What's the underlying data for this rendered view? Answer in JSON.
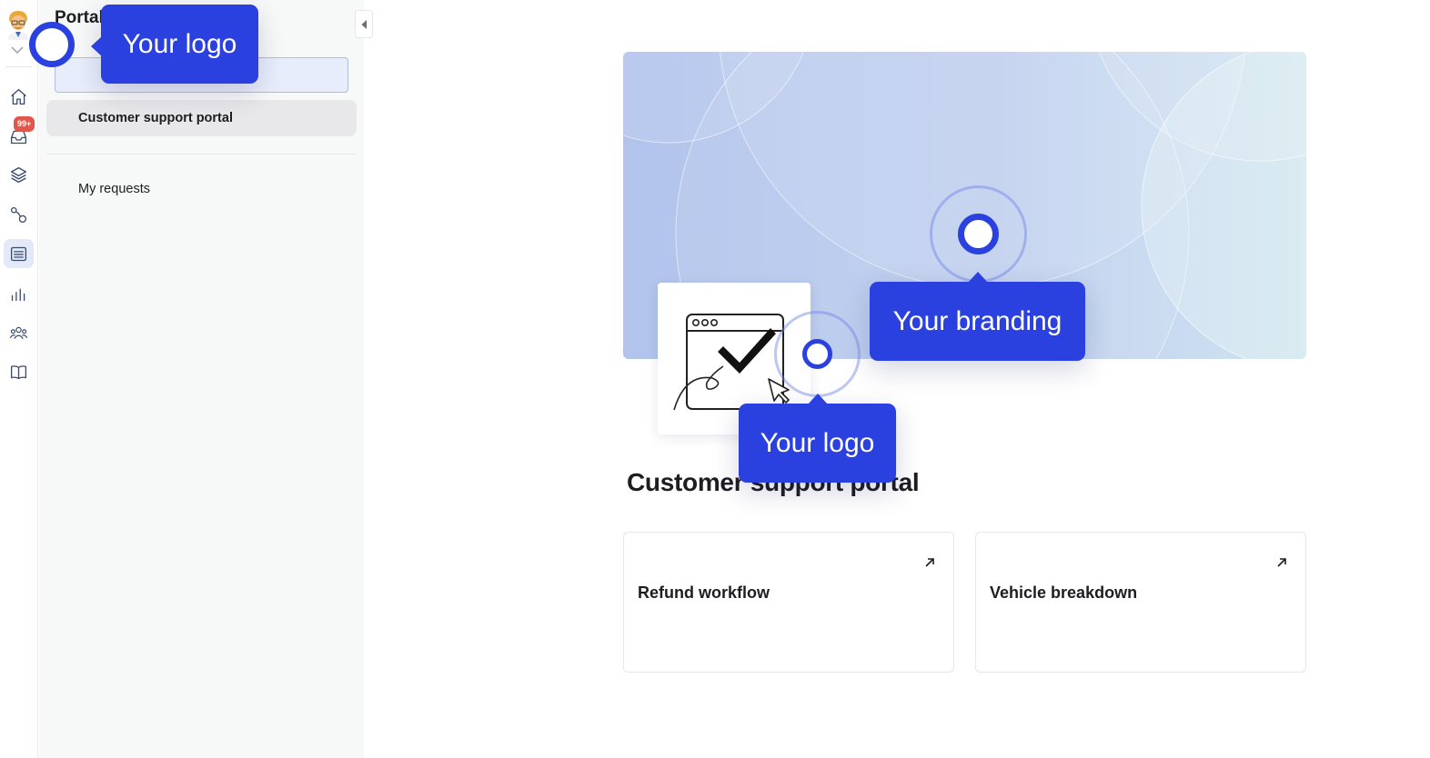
{
  "sidebar": {
    "title": "Portal",
    "badge": "99+",
    "icons": [
      "home-icon",
      "inbox-icon",
      "layers-icon",
      "workflow-icon",
      "portal-icon",
      "chart-icon",
      "team-icon",
      "book-icon"
    ],
    "active_icon": "portal-icon"
  },
  "panel": {
    "selected_item": "Customer support portal",
    "items": [
      {
        "label": "My requests"
      }
    ]
  },
  "main": {
    "heading": "Customer support portal",
    "cards": [
      {
        "title": "Refund workflow"
      },
      {
        "title": "Vehicle breakdown"
      }
    ]
  },
  "onboarding": {
    "logo_tip_top": "Your logo",
    "branding_tip": "Your branding",
    "logo_tip_bottom": "Your logo"
  },
  "colors": {
    "accent": "#2a41df",
    "badge": "#e2574c",
    "active_rail": "#e3e9f7",
    "panel_bg": "#f7f8f8"
  }
}
